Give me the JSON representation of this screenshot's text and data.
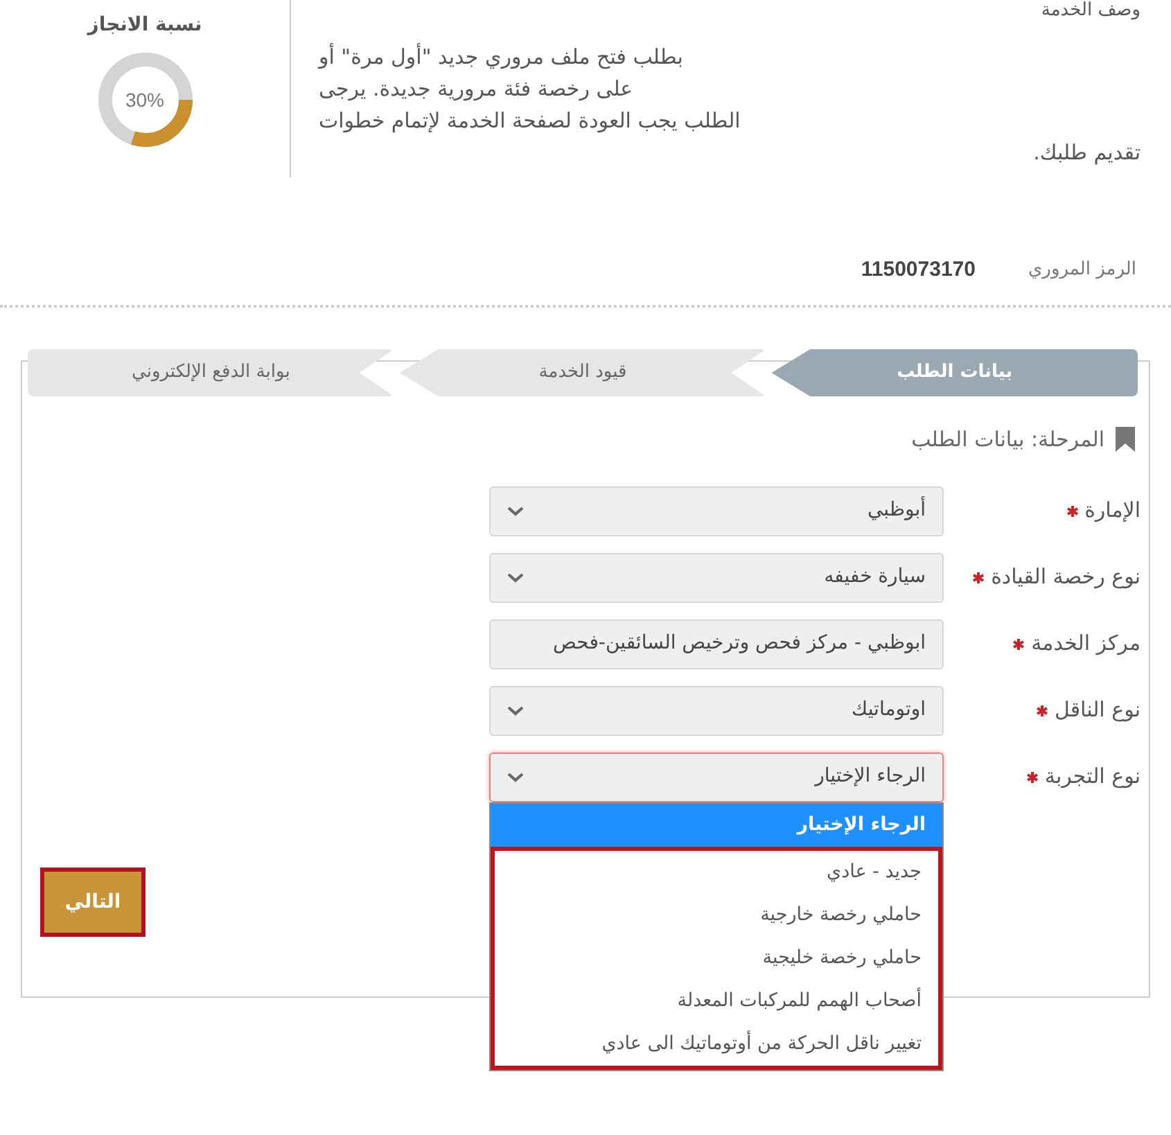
{
  "description": {
    "title": "وصف الخدمة",
    "lines": [
      {
        "text": "بطلب فتح ملف مروري جديد \"أول مرة\" أو",
        "partial": true
      },
      {
        "text": "على رخصة فئة مرورية جديدة. يرجى",
        "partial": true
      },
      {
        "text": "الطلب يجب العودة لصفحة الخدمة لإتمام خطوات",
        "partial": true
      },
      {
        "text": "تقديم طلبك.",
        "partial": false
      }
    ]
  },
  "progress": {
    "title": "نسبة الانجاز",
    "level": 0.3,
    "reading": "30%"
  },
  "traffic_code": {
    "label": "الرمز المروري",
    "value": "1150073170"
  },
  "steps": [
    {
      "label": "بيانات الطلب",
      "selected": true
    },
    {
      "label": "قيود الخدمة",
      "selected": false
    },
    {
      "label": "بوابة الدفع الإلكتروني",
      "selected": false
    }
  ],
  "stage": "المرحلة: بيانات الطلب",
  "fields": [
    {
      "label": "الإمارة",
      "required": true,
      "kind": "select",
      "value": "أبوظبي",
      "open": false
    },
    {
      "label": "نوع رخصة القيادة",
      "required": true,
      "kind": "select",
      "value": "سيارة خفيفه",
      "open": false
    },
    {
      "label": "مركز الخدمة",
      "required": true,
      "kind": "text",
      "value": "ابوظبي - مركز فحص وترخيص السائقين-فحص",
      "open": false
    },
    {
      "label": "نوع الناقل",
      "required": true,
      "kind": "select",
      "value": "اوتوماتيك",
      "open": false
    },
    {
      "label": "نوع التجربة",
      "required": true,
      "kind": "select",
      "value": "الرجاء الإختيار",
      "open": true,
      "options": [
        {
          "label": "الرجاء الإختيار",
          "selected": true
        },
        {
          "label": "جديد - عادي",
          "selected": false
        },
        {
          "label": "حاملي رخصة خارجية",
          "selected": false
        },
        {
          "label": "حاملي رخصة خليجية",
          "selected": false
        },
        {
          "label": "أصحاب الهمم للمركبات المعدلة",
          "selected": false
        },
        {
          "label": "تغيير ناقل الحركة من أوتوماتيك الى عادي",
          "selected": false
        }
      ]
    }
  ],
  "next_button": "التالي"
}
